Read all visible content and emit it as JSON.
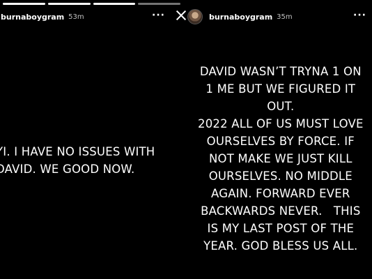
{
  "left_story": {
    "username": "burnaboygram",
    "timestamp": "53m",
    "more_label": "···",
    "text": "YI. I HAVE NO ISSUES WITH\nDAVID. WE GOOD NOW."
  },
  "right_story": {
    "username": "burnaboygram",
    "timestamp": "35m",
    "more_label": "···",
    "text": "DAVID WASN’T TRYNA 1 ON\n1 ME BUT WE FIGURED IT\nOUT.\n2022 ALL OF US MUST LOVE\nOURSELVES BY FORCE. IF\nNOT MAKE WE JUST KILL\nOURSELVES. NO MIDDLE\nAGAIN. FORWARD EVER\nBACKWARDS NEVER.   THIS\nIS MY LAST POST OF THE\nYEAR. GOD BLESS US ALL."
  },
  "icons": {
    "close": "close-icon",
    "more": "more-icon",
    "avatar": "avatar"
  },
  "colors": {
    "background": "#000000",
    "text": "#ffffff"
  }
}
